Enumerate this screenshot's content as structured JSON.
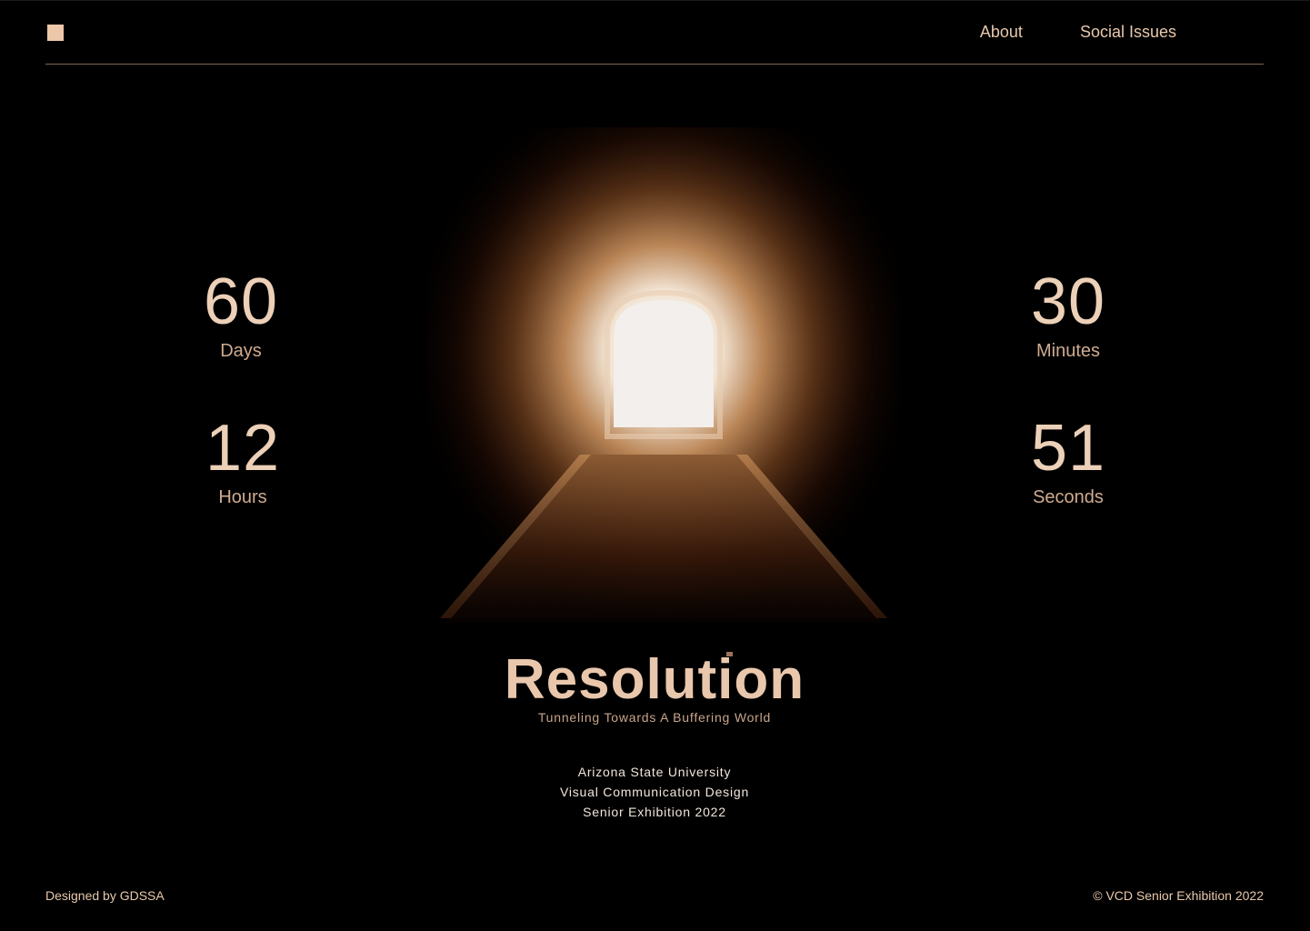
{
  "header": {
    "nav": [
      {
        "label": "About"
      },
      {
        "label": "Social Issues"
      }
    ]
  },
  "countdown": {
    "days": {
      "value": "60",
      "label": "Days"
    },
    "hours": {
      "value": "12",
      "label": "Hours"
    },
    "minutes": {
      "value": "30",
      "label": "Minutes"
    },
    "seconds": {
      "value": "51",
      "label": "Seconds"
    }
  },
  "hero": {
    "title": "Resolution",
    "subtitle": "Tunneling Towards A Buffering World"
  },
  "info": {
    "lines": [
      "Arizona State University",
      "Visual Communication Design",
      "Senior Exhibition 2022"
    ]
  },
  "footer": {
    "left": "Designed by GDSSA",
    "right": "© VCD Senior Exhibition 2022"
  },
  "colors": {
    "background": "#000000",
    "accent": "#edc7a9",
    "text_light": "#f2e6dc"
  }
}
